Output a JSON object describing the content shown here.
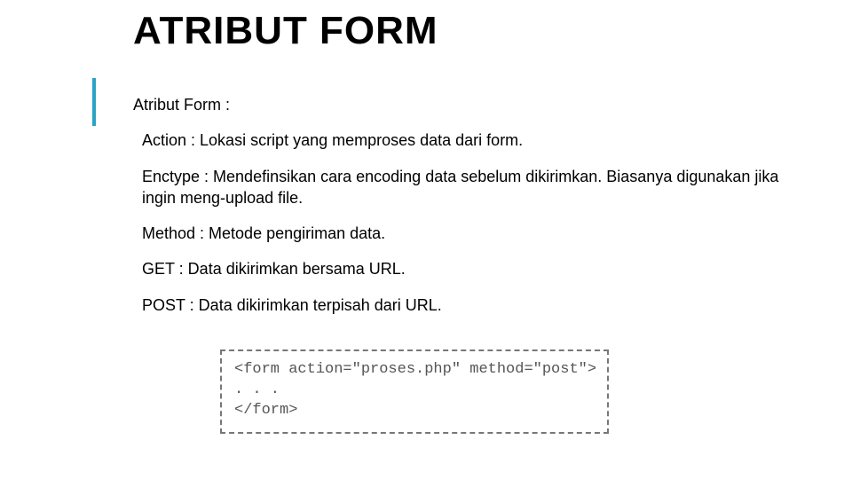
{
  "title": "ATRIBUT FORM",
  "intro": "Atribut Form :",
  "items": {
    "action": "Action : Lokasi script yang memproses data dari form.",
    "enctype": "Enctype : Mendefinsikan cara encoding data sebelum dikirimkan. Biasanya digunakan jika ingin meng‑upload file.",
    "method": "Method : Metode pengiriman data.",
    "get": "GET : Data dikirimkan bersama URL.",
    "post": "POST : Data dikirimkan terpisah dari URL."
  },
  "code": {
    "line1": "<form action=\"proses.php\" method=\"post\">",
    "line2": ". . .",
    "line3": "</form>"
  }
}
